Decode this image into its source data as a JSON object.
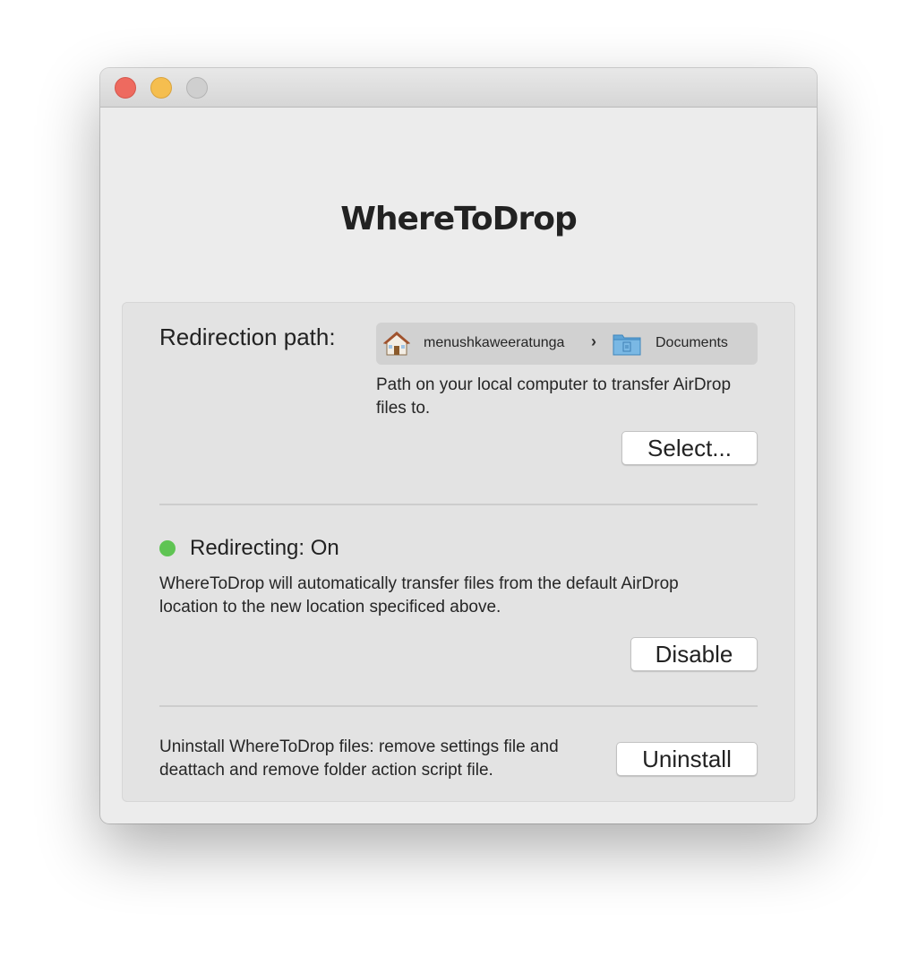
{
  "window": {
    "controls": [
      "close",
      "minimize",
      "zoom"
    ]
  },
  "app": {
    "title": "WhereToDrop"
  },
  "redirection": {
    "label": "Redirection path:",
    "path": {
      "home_icon": "home-icon",
      "home_label": "menushkaweeratunga",
      "separator": "›",
      "folder_icon": "folder-icon",
      "folder_label": "Documents"
    },
    "description": "Path on your local computer to transfer AirDrop files to.",
    "select_button": "Select..."
  },
  "status": {
    "label": "Redirecting: On",
    "color": "#5fc453",
    "description": "WhereToDrop will automatically transfer files from the default AirDrop location to the new location specificed above.",
    "disable_button": "Disable"
  },
  "uninstall": {
    "description": "Uninstall WhereToDrop files: remove settings file and deattach and remove folder action script file.",
    "uninstall_button": "Uninstall"
  }
}
